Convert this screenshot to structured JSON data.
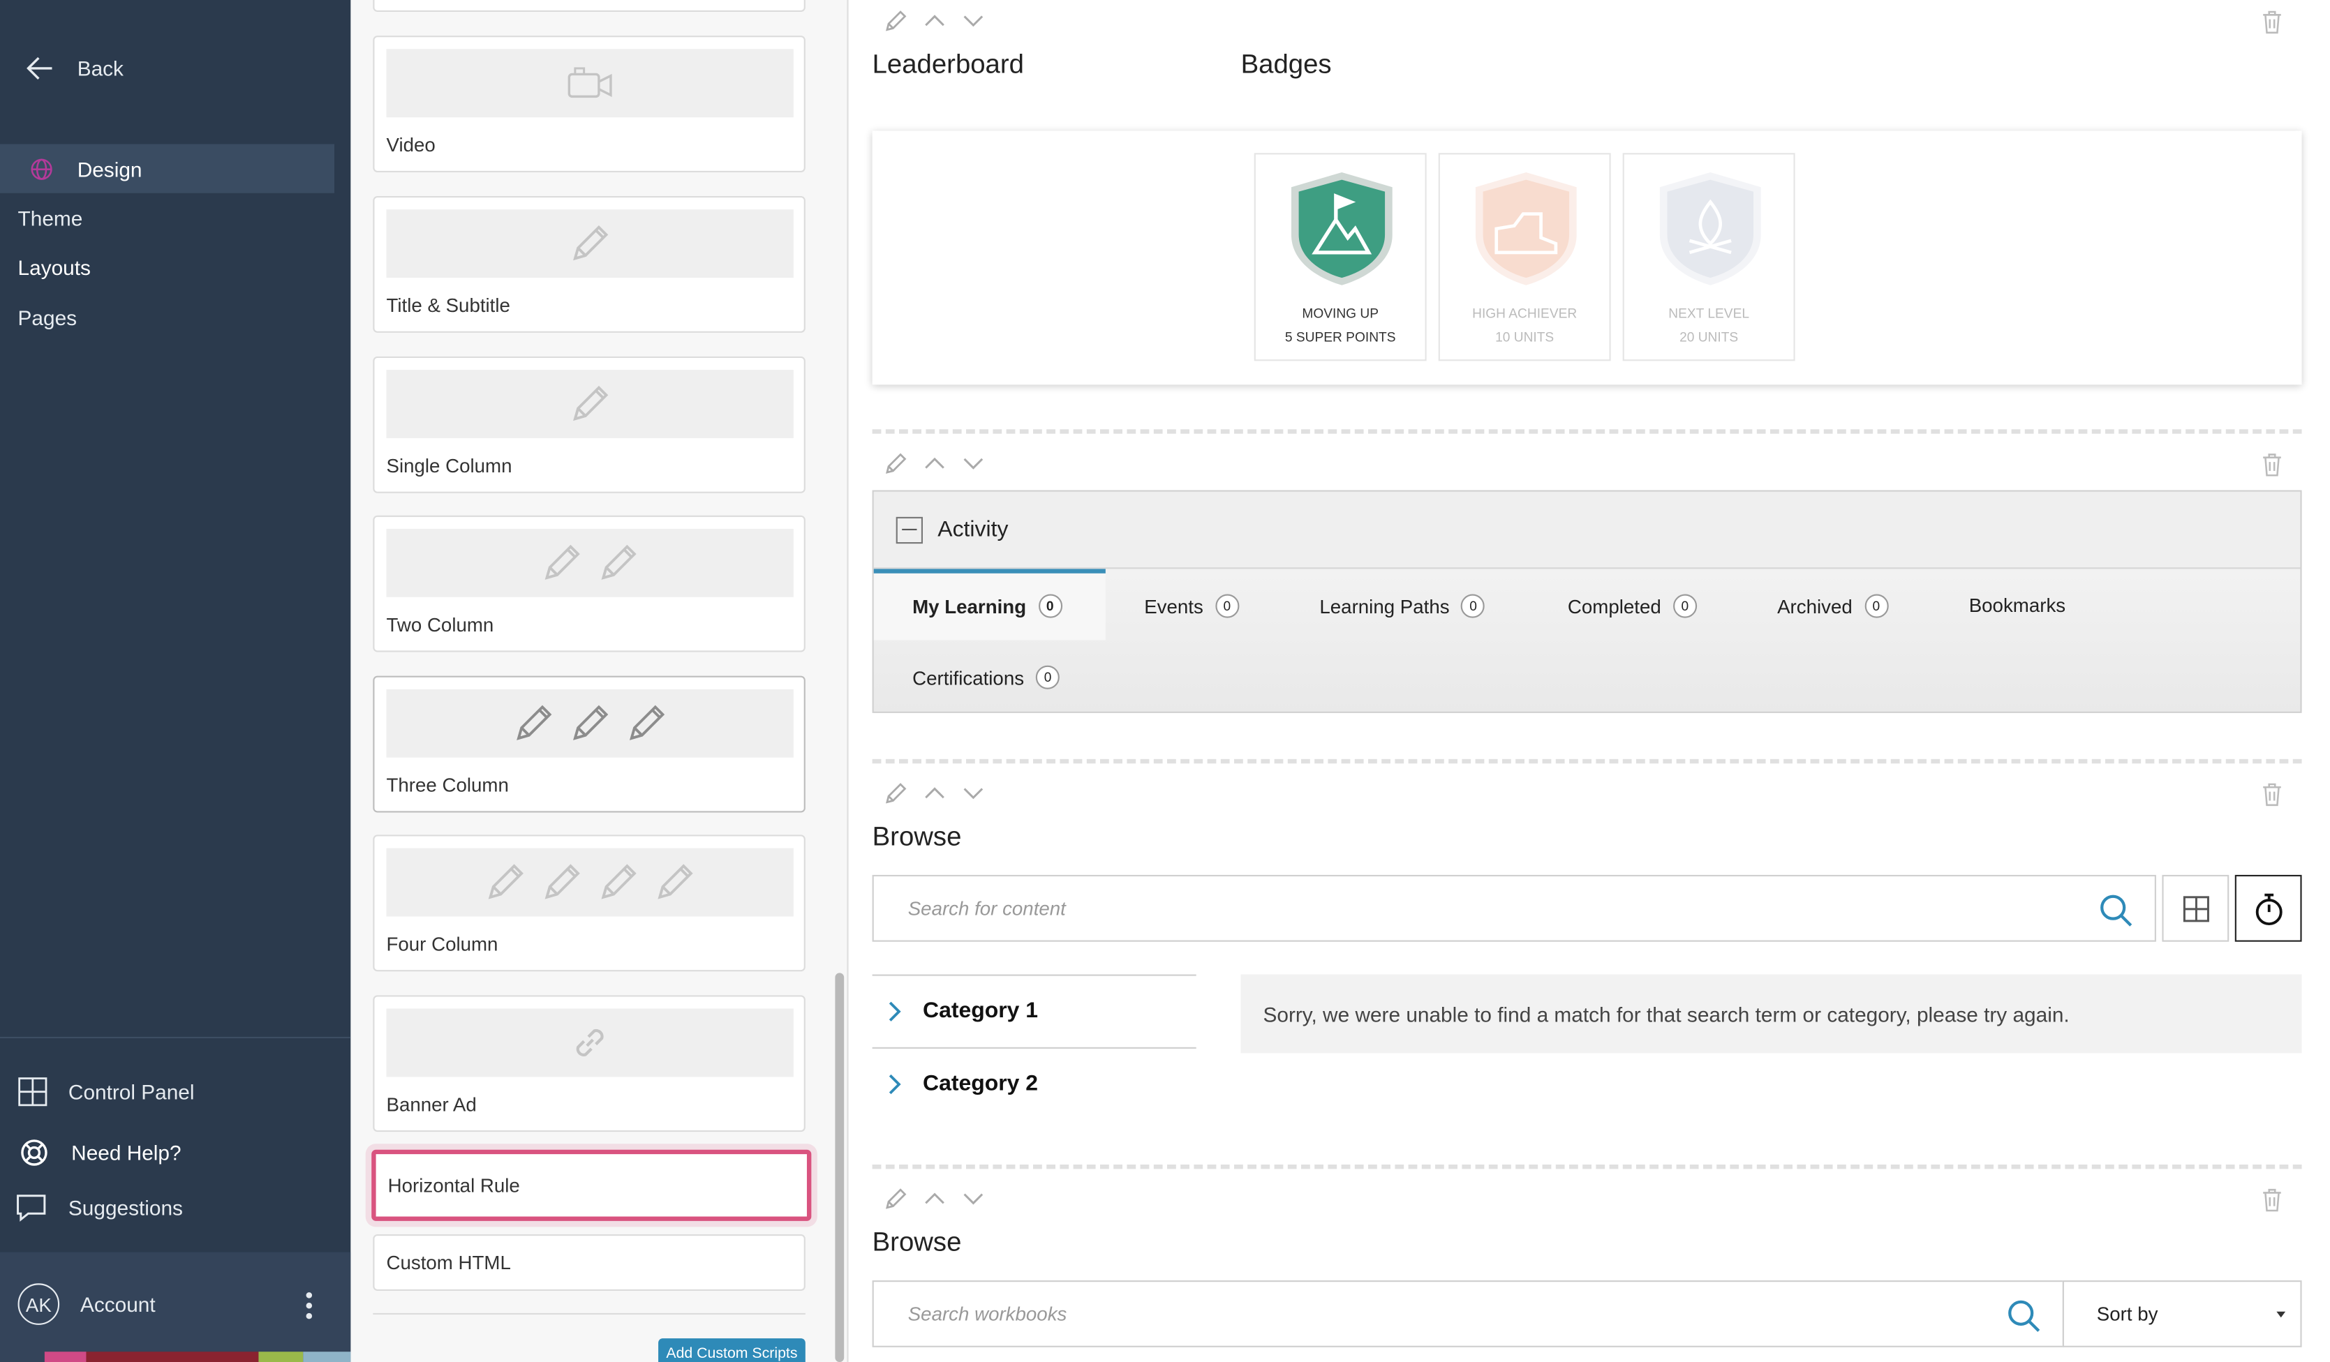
{
  "sidebar": {
    "back_label": "Back",
    "design_label": "Design",
    "sub_items": [
      "Theme",
      "Layouts",
      "Pages"
    ],
    "control_panel": "Control Panel",
    "need_help": "Need Help?",
    "suggestions": "Suggestions",
    "account_initials": "AK",
    "account_label": "Account"
  },
  "palette": {
    "cards": [
      {
        "label": "Video",
        "icon": "video-camera-icon"
      },
      {
        "label": "Title & Subtitle",
        "icon": "pencil-icon"
      },
      {
        "label": "Single Column",
        "icon": "pencil-icon"
      },
      {
        "label": "Two Column",
        "icon": "pencil-icon"
      },
      {
        "label": "Three Column",
        "icon": "pencil-icon"
      },
      {
        "label": "Four Column",
        "icon": "pencil-icon"
      },
      {
        "label": "Banner Ad",
        "icon": "link-icon"
      },
      {
        "label": "Horizontal Rule"
      },
      {
        "label": "Custom HTML"
      }
    ],
    "add_scripts_label": "Add Custom Scripts"
  },
  "main": {
    "leaderboard_title": "Leaderboard",
    "badges_title": "Badges",
    "badges": [
      {
        "line1": "MOVING UP",
        "line2": "5 SUPER POINTS",
        "earned": true,
        "color": "#3e9e82"
      },
      {
        "line1": "HIGH ACHIEVER",
        "line2": "10 UNITS",
        "earned": false,
        "color": "#f6d3c6"
      },
      {
        "line1": "NEXT LEVEL",
        "line2": "20 UNITS",
        "earned": false,
        "color": "#e5e8ee"
      }
    ],
    "activity": {
      "title": "Activity",
      "tabs": [
        {
          "label": "My Learning",
          "count": "0"
        },
        {
          "label": "Events",
          "count": "0"
        },
        {
          "label": "Learning Paths",
          "count": "0"
        },
        {
          "label": "Completed",
          "count": "0"
        },
        {
          "label": "Archived",
          "count": "0"
        },
        {
          "label": "Bookmarks"
        },
        {
          "label": "Certifications",
          "count": "0"
        }
      ]
    },
    "browse1": {
      "title": "Browse",
      "search_placeholder": "Search for content",
      "categories": [
        "Category 1",
        "Category 2"
      ],
      "no_match": "Sorry, we were unable to find a match for that search term or category, please try again."
    },
    "browse2": {
      "title": "Browse",
      "search_placeholder": "Search workbooks",
      "sort_label": "Sort by"
    }
  },
  "colors": {
    "sidebar_bg": "#2b3a4d",
    "accent": "#3a8fb8",
    "highlight": "#d9537f"
  }
}
